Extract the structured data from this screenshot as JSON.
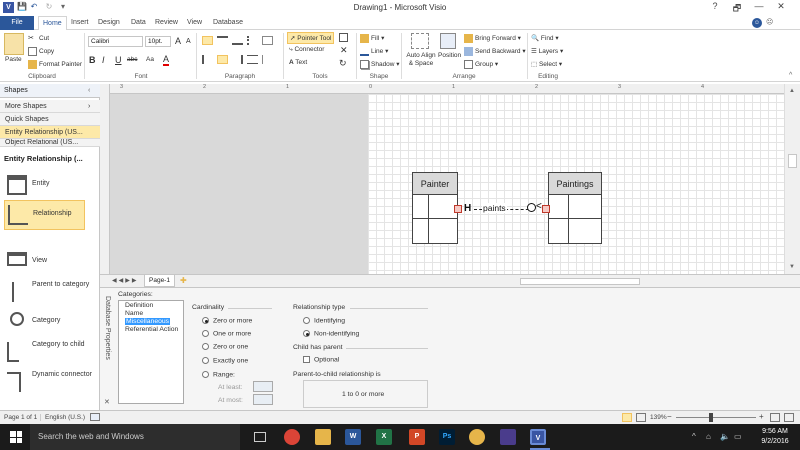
{
  "window": {
    "title": "Drawing1 - Microsoft Visio"
  },
  "quick_access": {
    "save": "💾",
    "undo": "↶",
    "redo": "↻",
    "more": "▾"
  },
  "window_controls": {
    "help": "?",
    "restore": "🗗",
    "minimize": "—",
    "maximize": "☐",
    "close": "✕"
  },
  "tabs": [
    "File",
    "Home",
    "Insert",
    "Design",
    "Data",
    "Review",
    "View",
    "Database"
  ],
  "ribbon": {
    "clipboard": {
      "paste": "Paste",
      "cut": "Cut",
      "copy": "Copy",
      "format_painter": "Format Painter",
      "label": "Clipboard"
    },
    "font": {
      "name": "Calibri",
      "size": "10pt.",
      "grow": "A",
      "shrink": "A",
      "clear": "A",
      "bold": "B",
      "italic": "I",
      "underline": "U",
      "strike": "abc",
      "case": "Aa",
      "color": "A",
      "label": "Font"
    },
    "paragraph": {
      "label": "Paragraph"
    },
    "tools": {
      "pointer": "Pointer Tool",
      "connector": "Connector",
      "text": "Text",
      "label": "Tools"
    },
    "shape": {
      "fill": "Fill",
      "line": "Line",
      "shadow": "Shadow",
      "label": "Shape"
    },
    "arrange": {
      "auto_align": "Auto Align & Space",
      "position": "Position",
      "bring_forward": "Bring Forward",
      "send_backward": "Send Backward",
      "group": "Group",
      "label": "Arrange"
    },
    "editing": {
      "find": "Find",
      "layers": "Layers",
      "select": "Select",
      "label": "Editing"
    }
  },
  "shapes_panel": {
    "header": "Shapes",
    "rows": [
      "More Shapes",
      "Quick Shapes",
      "Entity Relationship (US...",
      "Object Relational (US..."
    ],
    "section_title": "Entity Relationship (...",
    "items": [
      "Entity",
      "Relationship",
      "View",
      "Parent to category",
      "Category",
      "Category to child",
      "Dynamic connector"
    ]
  },
  "canvas": {
    "ruler_numbers": [
      "3",
      "2",
      "1",
      "0",
      "1",
      "2",
      "3",
      "4"
    ],
    "entities": [
      {
        "name": "Painter"
      },
      {
        "name": "Paintings"
      }
    ],
    "relationship_label": "paints"
  },
  "page_tabs": {
    "page": "Page-1"
  },
  "db_properties": {
    "side_label": "Database Properties",
    "categories_label": "Categories:",
    "categories": [
      "Definition",
      "Name",
      "Miscellaneous",
      "Referential Action"
    ],
    "selected_category": "Miscellaneous",
    "cardinality_title": "Cardinality",
    "cardinality_options": [
      "Zero or more",
      "One or more",
      "Zero or one",
      "Exactly one",
      "Range:"
    ],
    "cardinality_selected": "Zero or more",
    "at_least": "At least:",
    "at_most": "At most:",
    "relationship_type_title": "Relationship type",
    "relationship_options": [
      "Identifying",
      "Non-identifying"
    ],
    "relationship_selected": "Non-identifying",
    "child_has_parent_title": "Child has parent",
    "optional": "Optional",
    "parent_to_child_title": "Parent-to-child relationship is",
    "parent_to_child_value": "1  to  0 or more"
  },
  "status_bar": {
    "page": "Page 1 of 1",
    "language": "English (U.S.)",
    "zoom": "139%"
  },
  "taskbar": {
    "search": "Search the web and Windows",
    "time": "9:56 AM",
    "date": "9/2/2016"
  },
  "colors": {
    "accent": "#2b579a",
    "highlight": "#fde9a8",
    "taskbar": "#1b1b1b"
  }
}
